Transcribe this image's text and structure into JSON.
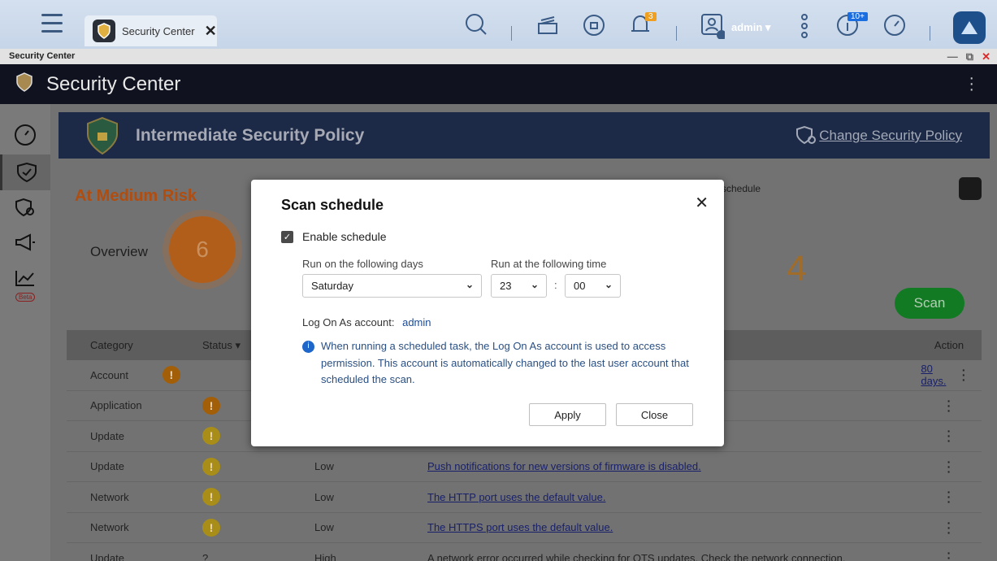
{
  "taskbar": {
    "tab_label": "Security Center",
    "notification_count": "3",
    "update_count": "10+",
    "user_name": "admin"
  },
  "window": {
    "title": "Security Center"
  },
  "app": {
    "title": "Security Center"
  },
  "banner": {
    "policy": "Intermediate Security Policy",
    "change_link": "Change Security Policy"
  },
  "summary": {
    "risk_label": "At Medium Risk",
    "overview_label": "Overview",
    "overview_count": "6",
    "secondary_count": "4",
    "schedule_hint": "schedule",
    "scan_label": "Scan"
  },
  "table": {
    "headers": {
      "category": "Category",
      "status": "Status",
      "action": "Action"
    },
    "rows": [
      {
        "category": "Account",
        "status_color": "orange",
        "severity": "",
        "description": "80 days."
      },
      {
        "category": "Application",
        "status_color": "orange",
        "severity": "",
        "description": ""
      },
      {
        "category": "Update",
        "status_color": "yellow",
        "severity": "",
        "description": ""
      },
      {
        "category": "Update",
        "status_color": "yellow",
        "severity": "Low",
        "description": "Push notifications for new versions of firmware is disabled."
      },
      {
        "category": "Network",
        "status_color": "yellow",
        "severity": "Low",
        "description": "The HTTP port uses the default value."
      },
      {
        "category": "Network",
        "status_color": "yellow",
        "severity": "Low",
        "description": "The HTTPS port uses the default value."
      },
      {
        "category": "Update",
        "status_color": "",
        "severity": "High",
        "description": "A network error occurred while checking for QTS updates. Check the network connection."
      }
    ]
  },
  "dialog": {
    "title": "Scan schedule",
    "enable_label": "Enable schedule",
    "days_label": "Run on the following days",
    "time_label": "Run at the following time",
    "day_value": "Saturday",
    "hour_value": "23",
    "minute_value": "00",
    "logon_label": "Log On As account:",
    "logon_account": "admin",
    "info_text": "When running a scheduled task, the Log On As account is used to access permission. This account is automatically changed to the last user account that scheduled the scan.",
    "apply_label": "Apply",
    "close_label": "Close"
  }
}
